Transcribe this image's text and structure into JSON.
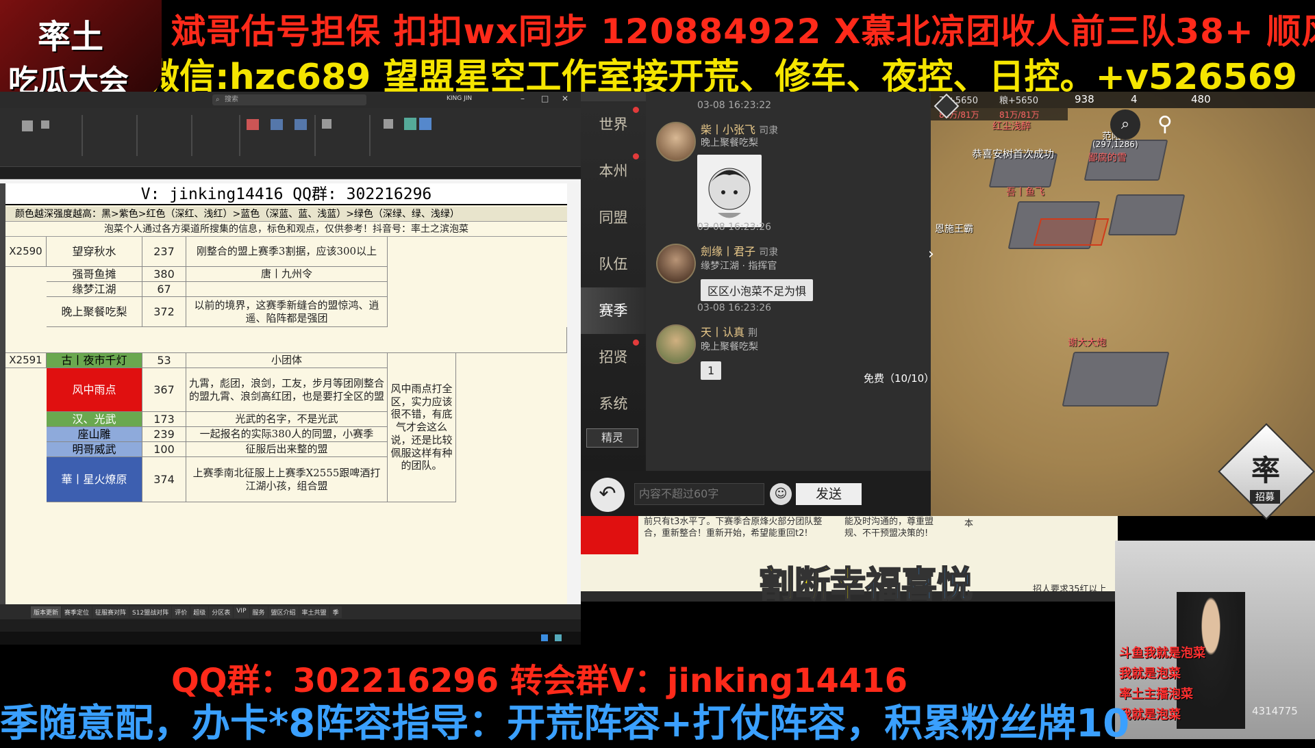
{
  "banner": {
    "line1": "斌哥估号担保 扣扣wx同步 120884922    X慕北凉团收人前三队38+  顺风不",
    "line2": "微信:hzc689    望盟星空工作室接开荒、修车、夜控、日控。+v526569"
  },
  "logo": {
    "line1": "率土",
    "line2": "吃瓜大会"
  },
  "excel": {
    "window_title": "KING JIN",
    "search_placeholder": "搜索",
    "sheet_title": "V: jinking14416 QQ群: 302216296",
    "legend": "颜色越深强度越高：黑>紫色>红色（深红、浅红）>蓝色（深蓝、蓝、浅蓝）>绿色（深绿、绿、浅绿）",
    "note": "泡菜个人通过各方渠道所搜集的信息，标色和观点，仅供参考！抖音号：率土之滨泡菜",
    "rows": [
      {
        "server": "X2590",
        "name": "望穿秋水",
        "value": "237",
        "comment": "刚整合的盟上赛季3割据，应该300以上"
      },
      {
        "server": "",
        "name": "强哥鱼摊",
        "value": "380",
        "comment": "唐丨九州令"
      },
      {
        "server": "",
        "name": "缘梦江湖",
        "value": "67",
        "comment": ""
      },
      {
        "server": "",
        "name": "晚上聚餐吃梨",
        "value": "372",
        "comment": "以前的境界，这赛季新缝合的盟惊鸿、逍遥、陷阵都是强团"
      },
      {
        "server": "X2591",
        "name": "古丨夜市千灯",
        "value": "53",
        "comment": "小团体"
      },
      {
        "server": "",
        "name": "风中雨点",
        "value": "367",
        "comment": "九霄，彪团，浪剑，工友，步月等团刚整合的盟九霄、浪剑高红团，也是要打全区的盟"
      },
      {
        "server": "",
        "name": "汉、光武",
        "value": "173",
        "comment": "光武的名字，不是光武"
      },
      {
        "server": "",
        "name": "座山雕",
        "value": "239",
        "comment": "一起报名的实际380人的同盟，小赛季"
      },
      {
        "server": "",
        "name": "明哥威武",
        "value": "100",
        "comment": "征服后出来整的盟"
      },
      {
        "server": "",
        "name": "華丨星火燎原",
        "value": "374",
        "comment": "上赛季南北征服上上赛季X2555跟啤酒打江湖小孩，组合盟"
      }
    ],
    "side_comment": "风中雨点打全区，实力应该很不错，有底气才会这么说，还是比较佩服这样有种的团队。",
    "tabs": [
      "版本更新",
      "赛季定位",
      "征服赛对阵",
      "S12盟战对阵",
      "评价",
      "超级",
      "分区表",
      "VIP",
      "服务",
      "盟区介绍",
      "率土共盟",
      "季"
    ]
  },
  "game": {
    "menu": [
      "世界",
      "本州",
      "同盟",
      "队伍",
      "赛季",
      "招贤",
      "系统",
      "精灵"
    ],
    "resources": {
      "stone": "石+5650",
      "stone_cap": "81万/81万",
      "grain": "粮+5650",
      "grain_cap": "81万/81万",
      "jade": "938",
      "tokens": "4",
      "gold": "480"
    },
    "messages": [
      {
        "time": "03-08 16:23:22"
      },
      {
        "name": "柴丨小张飞",
        "role": "司隶",
        "sub": "晚上聚餐吃梨",
        "time": "03-08 16:23:26"
      },
      {
        "name": "劍缘丨君子",
        "role": "司隶",
        "sub": "缘梦江湖 · 指挥官",
        "text": "区区小泡菜不足为惧",
        "time": "03-08 16:23:26"
      },
      {
        "name": "天丨认真",
        "role": "荆",
        "sub": "晚上聚餐吃梨",
        "text": "1"
      }
    ],
    "input_placeholder": "内容不超过60字",
    "send": "发送",
    "free_count": "免费（10/10）",
    "map": {
      "labels": [
        "红尘浅醉",
        "恭喜安树首次成功",
        "范阳",
        "(297,1286)",
        "吾丨鱼飞",
        "恩施王霸",
        "谢大大炮",
        "鄙腐的雪"
      ],
      "seal": "率",
      "recruit": "招募"
    }
  },
  "lower": {
    "overlay": "割断幸福喜悦",
    "snippets": [
      "前只有t3水平了。下赛季合原烽火部分团队整合，重新整合！重新开始，希望能重回t2!",
      "能及时沟通的，尊重盟规、不干预盟决策的!",
      "本",
      "招人要求35红以上"
    ]
  },
  "bottom": {
    "line1": "QQ群：302216296     转会群V：jinking14416",
    "line2": "季随意配，办卡*8阵容指导：开荒阵容+打仗阵容，积累粉丝牌10"
  },
  "webcam": {
    "labels": [
      "斗鱼我就是泡菜",
      "我就是泡菜",
      "率土主播泡菜",
      "我就是泡菜"
    ],
    "count": "4314775"
  },
  "colors": {
    "red_banner": "#ff2a1a",
    "yellow_banner": "#f5e500",
    "blue_banner": "#3aa0ff",
    "cell_red": "#e01010",
    "cell_green": "#6aa84f",
    "cell_blue": "#8eaadb",
    "cell_darkblue": "#3d5fb0"
  }
}
